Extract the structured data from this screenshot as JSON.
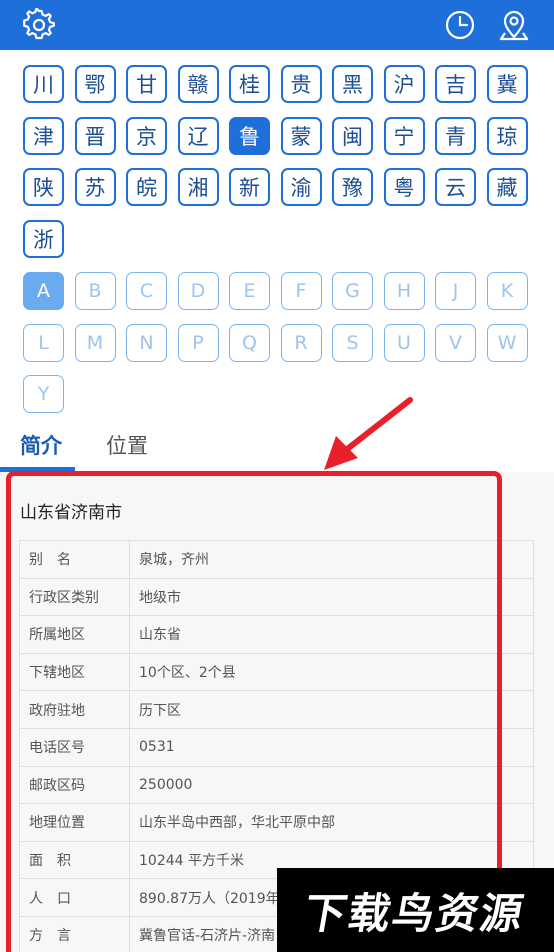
{
  "header": {
    "settings_icon": "gear-icon",
    "history_icon": "clock-icon",
    "location_icon": "location-pin-icon",
    "bg_color": "#1e6fd9"
  },
  "provinces": [
    "川",
    "鄂",
    "甘",
    "赣",
    "桂",
    "贵",
    "黑",
    "沪",
    "吉",
    "冀",
    "津",
    "晋",
    "京",
    "辽",
    "鲁",
    "蒙",
    "闽",
    "宁",
    "青",
    "琼",
    "陕",
    "苏",
    "皖",
    "湘",
    "新",
    "渝",
    "豫",
    "粤",
    "云",
    "藏",
    "浙"
  ],
  "selected_province": "鲁",
  "letters": [
    "A",
    "B",
    "C",
    "D",
    "E",
    "F",
    "G",
    "H",
    "J",
    "K",
    "L",
    "M",
    "N",
    "P",
    "Q",
    "R",
    "S",
    "U",
    "V",
    "W",
    "Y"
  ],
  "selected_letter": "A",
  "tabs": [
    {
      "label": "简介",
      "active": true
    },
    {
      "label": "位置",
      "active": false
    }
  ],
  "place": {
    "title": "山东省济南市",
    "rows": [
      {
        "key": "别　名",
        "value": "泉城，齐州"
      },
      {
        "key": "行政区类别",
        "value": "地级市"
      },
      {
        "key": "所属地区",
        "value": "山东省"
      },
      {
        "key": "下辖地区",
        "value": "10个区、2个县"
      },
      {
        "key": "政府驻地",
        "value": "历下区"
      },
      {
        "key": "电话区号",
        "value": "0531"
      },
      {
        "key": "邮政区码",
        "value": "250000"
      },
      {
        "key": "地理位置",
        "value": "山东半岛中西部，华北平原中部"
      },
      {
        "key": "面　积",
        "value": "10244 平方千米"
      },
      {
        "key": "人　口",
        "value": "890.87万人（2019年"
      },
      {
        "key": "方　言",
        "value": "冀鲁官话-石济片-济南"
      }
    ]
  },
  "watermark": "下载鸟资源",
  "annotation_color": "#e8202a"
}
